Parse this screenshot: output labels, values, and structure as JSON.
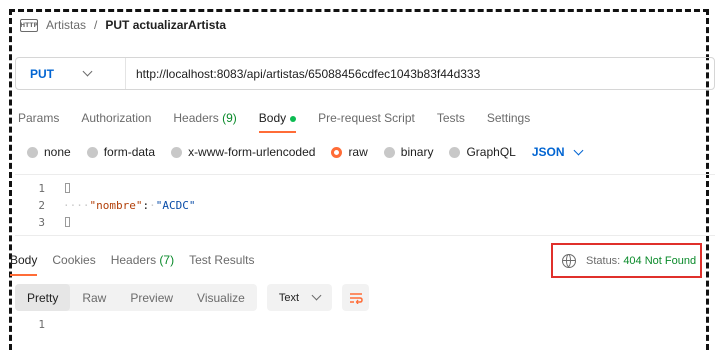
{
  "breadcrumb": {
    "icon_text": "HTTP",
    "parent": "Artistas",
    "separator": "/",
    "current": "PUT actualizarArtista"
  },
  "request": {
    "method": "PUT",
    "url": "http://localhost:8083/api/artistas/65088456cdfec1043b83f44d333"
  },
  "request_tabs": {
    "params": "Params",
    "authorization": "Authorization",
    "headers": "Headers",
    "headers_count": "(9)",
    "body": "Body",
    "prerequest": "Pre-request Script",
    "tests": "Tests",
    "settings": "Settings"
  },
  "body_types": {
    "none": "none",
    "form_data": "form-data",
    "urlencoded": "x-www-form-urlencoded",
    "raw": "raw",
    "binary": "binary",
    "graphql": "GraphQL",
    "language": "JSON"
  },
  "editor": {
    "line1": "1",
    "line2": "2",
    "line3": "3",
    "indent": "····",
    "key": "\"nombre\"",
    "colon": ":",
    "space": "·",
    "value": "\"ACDC\""
  },
  "response_tabs": {
    "body": "Body",
    "cookies": "Cookies",
    "headers": "Headers",
    "headers_count": "(7)",
    "test_results": "Test Results"
  },
  "status": {
    "label": "Status:",
    "value": "404 Not Found"
  },
  "view_modes": {
    "pretty": "Pretty",
    "raw": "Raw",
    "preview": "Preview",
    "visualize": "Visualize",
    "format": "Text"
  },
  "response_lines": {
    "line1": "1"
  },
  "colors": {
    "accent": "#ff6c37",
    "method_blue": "#0265d2",
    "status_green": "#0a8a2a",
    "highlight_red": "#e0302b"
  },
  "icons": [
    "http-icon",
    "chevron-down-icon",
    "globe-icon",
    "wrap-lines-icon"
  ]
}
